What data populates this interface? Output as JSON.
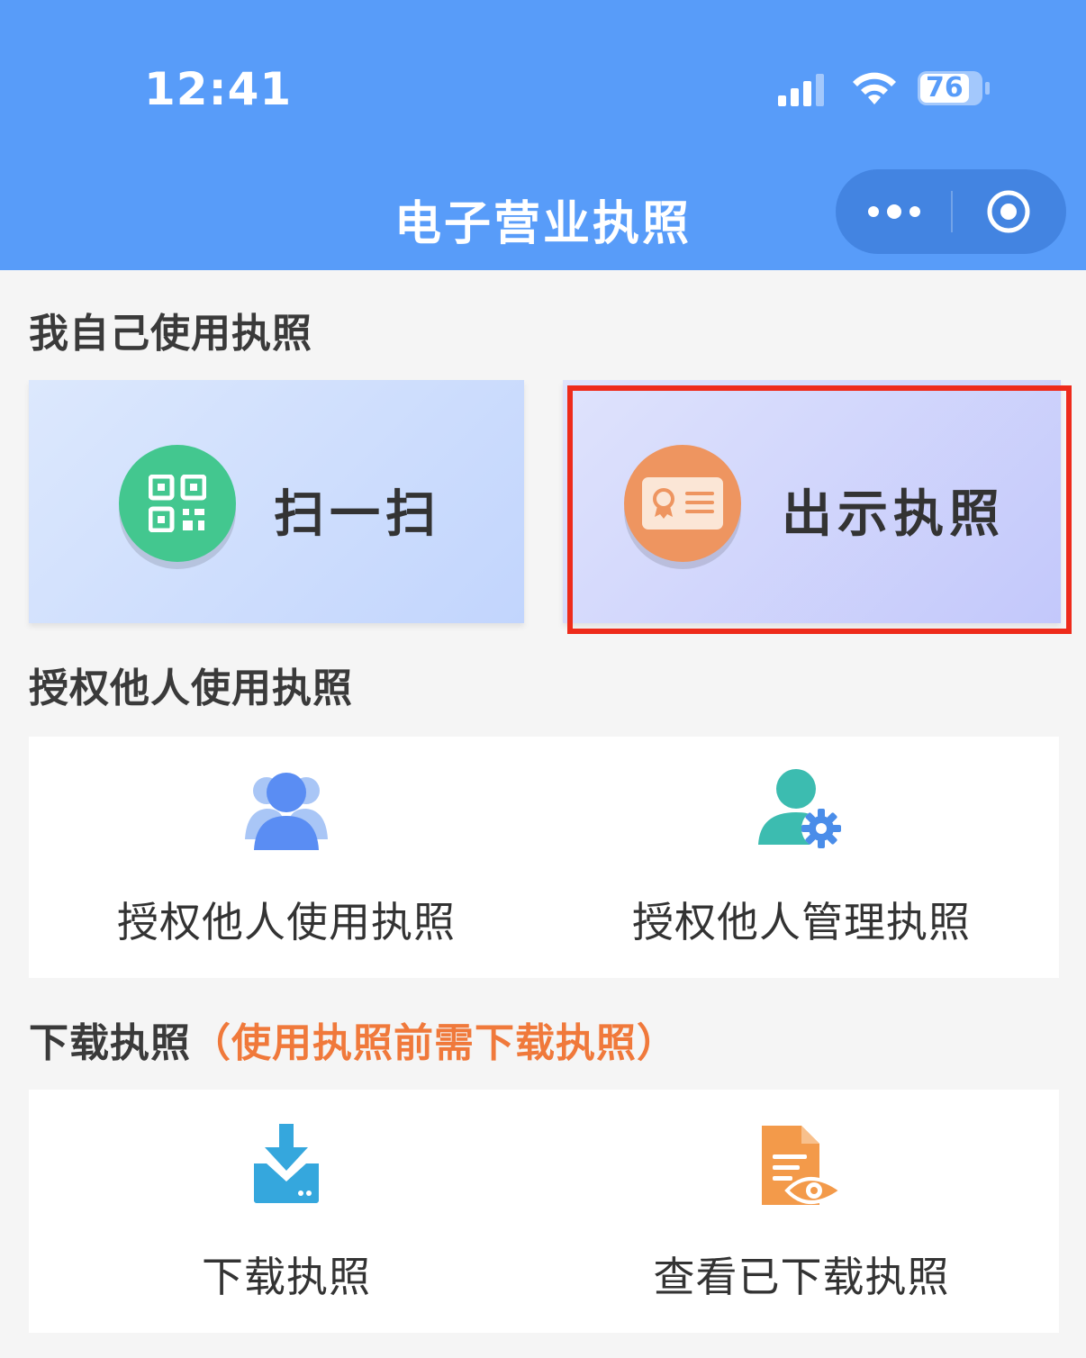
{
  "status_bar": {
    "time": "12:41",
    "battery": "76"
  },
  "nav": {
    "title": "电子营业执照"
  },
  "self_use": {
    "section_title": "我自己使用执照",
    "scan_label": "扫一扫",
    "show_label": "出示执照"
  },
  "authorize": {
    "section_title": "授权他人使用执照",
    "items": [
      {
        "label": "授权他人使用执照"
      },
      {
        "label": "授权他人管理执照"
      }
    ]
  },
  "download": {
    "section_title": "下载执照",
    "section_note": "（使用执照前需下载执照）",
    "items": [
      {
        "label": "下载执照"
      },
      {
        "label": "查看已下载执照"
      }
    ]
  },
  "colors": {
    "header_bg": "#589cf9",
    "highlight": "#ee2b1b",
    "note": "#f0793b",
    "scan_icon": "#43c78f",
    "show_icon": "#ee9560"
  }
}
